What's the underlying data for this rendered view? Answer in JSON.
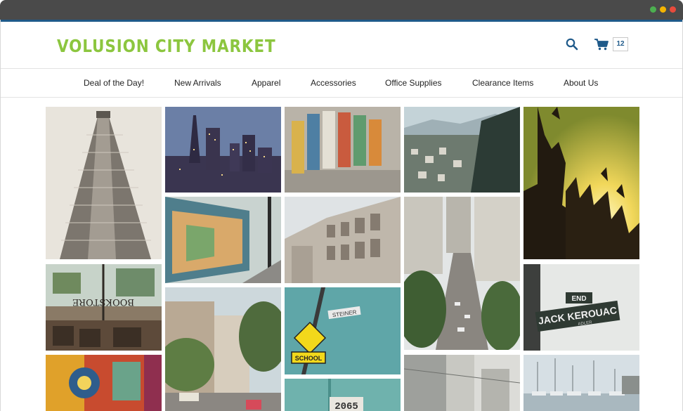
{
  "colors": {
    "chrome": "#4a4a4a",
    "accent_line": "#1f5a8a",
    "logo": "#8cc63f",
    "icon": "#1f5a8a",
    "dot_green": "#4caf50",
    "dot_yellow": "#f4b400",
    "dot_red": "#e94b3c"
  },
  "window": {
    "controls": [
      "maximize-dot",
      "minimize-dot",
      "close-dot"
    ]
  },
  "header": {
    "logo_text": "VOLUSION CITY MARKET",
    "search_icon": "search-icon",
    "cart_icon": "cart-icon",
    "cart_count": "12"
  },
  "nav": {
    "items": [
      {
        "label": "Deal of the Day!"
      },
      {
        "label": "New Arrivals"
      },
      {
        "label": "Apparel"
      },
      {
        "label": "Accessories"
      },
      {
        "label": "Office Supplies"
      },
      {
        "label": "Clearance Items"
      },
      {
        "label": "About Us"
      }
    ]
  },
  "gallery": {
    "photos": [
      {
        "subject": "flatiron-building-photo"
      },
      {
        "subject": "city-skyline-night-photo"
      },
      {
        "subject": "painted-benches-photo"
      },
      {
        "subject": "bay-bridge-view-photo"
      },
      {
        "subject": "concert-crowd-photo"
      },
      {
        "subject": "mural-wall-street-photo"
      },
      {
        "subject": "victorian-houses-photo"
      },
      {
        "subject": "downtown-hill-street-photo"
      },
      {
        "subject": "bookstore-window-photo"
      },
      {
        "subject": "street-trees-houses-photo"
      },
      {
        "subject": "school-sign-photo"
      },
      {
        "subject": "jack-kerouac-sign-photo"
      },
      {
        "subject": "colorful-mural-photo"
      },
      {
        "subject": "building-number-photo"
      },
      {
        "subject": "building-corner-photo"
      },
      {
        "subject": "marina-boats-photo"
      }
    ],
    "visible_text": {
      "bookstore_window": "BOOKSTORE",
      "street_sign_name": "STEINER",
      "school_sign": "SCHOOL",
      "end_sign": "END",
      "kerouac_sign": "JACK KEROUAC",
      "kerouac_sub": "ADLER",
      "building_number": "2065"
    }
  }
}
